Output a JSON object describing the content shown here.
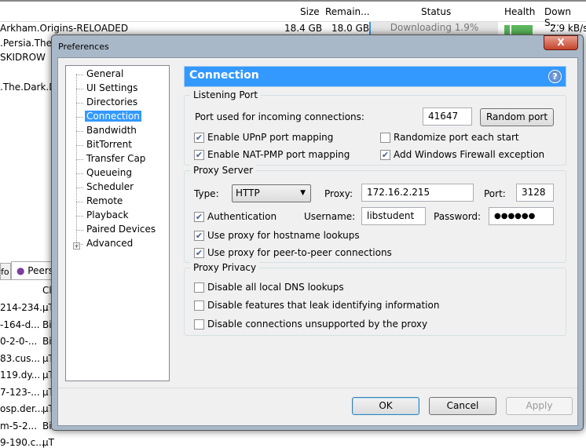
{
  "background": {
    "columns": [
      "Size",
      "Remain...",
      "Status",
      "Health",
      "Down S..."
    ],
    "torrents": [
      {
        "name": "Arkham.Origins-RELOADED",
        "size": "18.4 GB",
        "remaining": "18.0 GB",
        "status": "Downloading 1.9%",
        "down": "2.9 kB/s"
      },
      {
        "name": ".Persia.The.F"
      },
      {
        "name": "SKIDROW"
      },
      {
        "name": ".The.Dark.De"
      }
    ],
    "tabs": [
      "fo",
      "Peers"
    ],
    "peer_col": "Cl",
    "peers": [
      [
        "214-234...",
        "µT"
      ],
      [
        "-164-d...",
        "Bi"
      ],
      [
        "0-2-0-...",
        "Bi"
      ],
      [
        "83.cus...",
        "µT"
      ],
      [
        "119.dy...",
        "µT"
      ],
      [
        "7-123-...",
        "µT"
      ],
      [
        "osp.der...",
        "µT"
      ],
      [
        "m-5-2...",
        "Bi"
      ],
      [
        "9-190.c...",
        "µT"
      ]
    ]
  },
  "dialog": {
    "title": "Preferences",
    "close": "X",
    "tree": [
      "General",
      "UI Settings",
      "Directories",
      "Connection",
      "Bandwidth",
      "BitTorrent",
      "Transfer Cap",
      "Queueing",
      "Scheduler",
      "Remote",
      "Playback",
      "Paired Devices",
      "Advanced"
    ],
    "selected": "Connection",
    "header": "Connection",
    "help": "?",
    "listening": {
      "label": "Listening Port",
      "port_label": "Port used for incoming connections:",
      "port": "41647",
      "random_btn": "Random port",
      "upnp": {
        "label": "Enable UPnP port mapping",
        "checked": true
      },
      "natpmp": {
        "label": "Enable NAT-PMP port mapping",
        "checked": true
      },
      "randomize": {
        "label": "Randomize port each start",
        "checked": false
      },
      "firewall": {
        "label": "Add Windows Firewall exception",
        "checked": true
      }
    },
    "proxy": {
      "label": "Proxy Server",
      "type_label": "Type:",
      "type": "HTTP",
      "proxy_label": "Proxy:",
      "proxy": "172.16.2.215",
      "port_label": "Port:",
      "port": "3128",
      "auth": {
        "label": "Authentication",
        "checked": true
      },
      "user_label": "Username:",
      "user": "libstudent",
      "pass_label": "Password:",
      "pass": "●●●●●●",
      "hostname": {
        "label": "Use proxy for hostname lookups",
        "checked": true
      },
      "p2p": {
        "label": "Use proxy for peer-to-peer connections",
        "checked": true
      }
    },
    "privacy": {
      "label": "Proxy Privacy",
      "dns": {
        "label": "Disable all local DNS lookups",
        "checked": false
      },
      "leak": {
        "label": "Disable features that leak identifying information",
        "checked": false
      },
      "unsupported": {
        "label": "Disable connections unsupported by the proxy",
        "checked": false
      }
    },
    "buttons": {
      "ok": "OK",
      "cancel": "Cancel",
      "apply": "Apply"
    }
  }
}
